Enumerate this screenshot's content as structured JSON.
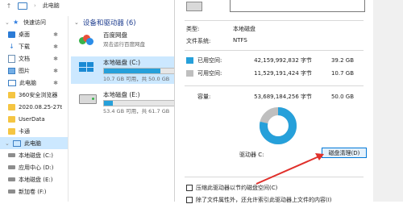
{
  "titlebar": {
    "breadcrumb": "此电脑"
  },
  "sidebar": {
    "items": [
      {
        "label": "快速访问",
        "icon": "star-icon",
        "pinned": false,
        "expand": true
      },
      {
        "label": "桌面",
        "icon": "desktop-icon",
        "pinned": true
      },
      {
        "label": "下载",
        "icon": "download-icon",
        "pinned": true
      },
      {
        "label": "文档",
        "icon": "document-icon",
        "pinned": true
      },
      {
        "label": "图片",
        "icon": "picture-icon",
        "pinned": true
      },
      {
        "label": "此电脑",
        "icon": "computer-icon",
        "pinned": true
      },
      {
        "label": "360安全浏览器",
        "icon": "folder-icon",
        "pinned": false
      },
      {
        "label": "2020.08.25-27t",
        "icon": "folder-icon",
        "pinned": false
      },
      {
        "label": "UserData",
        "icon": "folder-icon",
        "pinned": false
      },
      {
        "label": "卡通",
        "icon": "folder-icon",
        "pinned": false
      },
      {
        "label": "此电脑",
        "icon": "computer-icon",
        "pinned": false,
        "expand": true,
        "selected": true
      },
      {
        "label": "本地磁盘 (C:)",
        "icon": "drive-icon",
        "pinned": false
      },
      {
        "label": "应用中心 (D:)",
        "icon": "drive-icon",
        "pinned": false
      },
      {
        "label": "本地磁盘 (E:)",
        "icon": "drive-icon",
        "pinned": false
      },
      {
        "label": "新加卷 (F:)",
        "icon": "drive-icon",
        "pinned": false
      }
    ]
  },
  "content": {
    "group_title": "设备和驱动器 (6)",
    "tiles": [
      {
        "name": "百度网盘",
        "sub": "双击运行百度网盘",
        "icon": "baidu-netdisk-icon",
        "selected": false
      },
      {
        "name": "本地磁盘 (C:)",
        "sub": "10.7 GB 可用，共 50.0 GB",
        "icon": "windows-drive-icon",
        "fill": 0.79,
        "selected": true
      },
      {
        "name": "本地磁盘 (E:)",
        "sub": "53.4 GB 可用，共 61.7 GB",
        "icon": "drive-icon",
        "fill": 0.13,
        "selected": false
      }
    ]
  },
  "properties": {
    "type_label": "类型:",
    "type_value": "本地磁盘",
    "fs_label": "文件系统:",
    "fs_value": "NTFS",
    "used_label": "已用空间:",
    "used_bytes": "42,159,992,832 字节",
    "used_hr": "39.2 GB",
    "free_label": "可用空间:",
    "free_bytes": "11,529,191,424 字节",
    "free_hr": "10.7 GB",
    "cap_label": "容量:",
    "cap_bytes": "53,689,184,256 字节",
    "cap_hr": "50.0 GB",
    "drive_label": "驱动器 C:",
    "cleanup_label": "磁盘清理(D)",
    "compress_label": "压缩此驱动器以节约磁盘空间(C)",
    "index_label": "除了文件属性外，还允许索引此驱动器上文件的内容(I)",
    "used_fraction": 0.785,
    "colors": {
      "used": "#26a0da",
      "free": "#bfbfbf",
      "arrow": "#e0302b"
    }
  }
}
